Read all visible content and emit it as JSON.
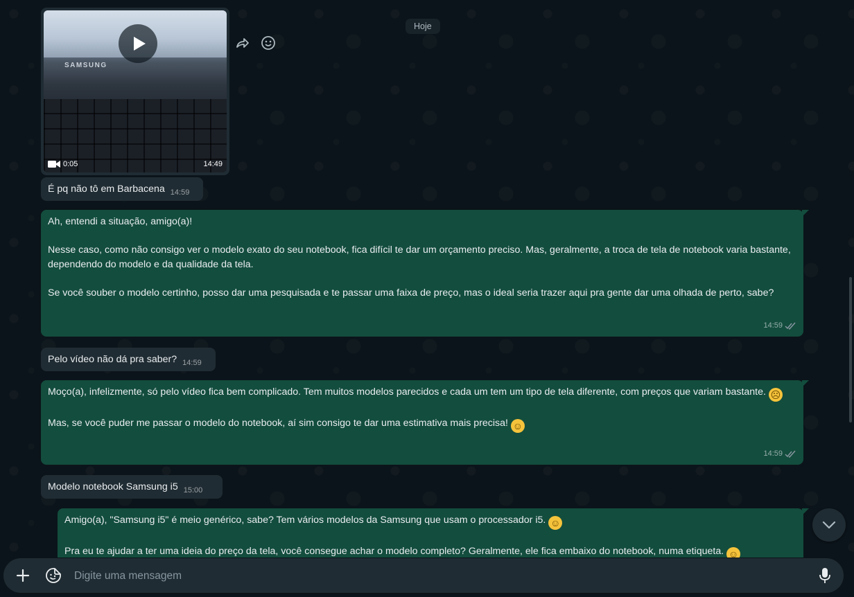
{
  "date_chip": "Hoje",
  "video_message": {
    "duration": "0:05",
    "time": "14:49",
    "thumb_brand": "SAMSUNG"
  },
  "messages": [
    {
      "direction": "incoming",
      "text": "É pq não tô em Barbacena",
      "time": "14:59"
    },
    {
      "direction": "outgoing",
      "text": "Ah, entendi a situação, amigo(a)!\n\nNesse caso, como não consigo ver o modelo exato do seu notebook, fica difícil te dar um orçamento preciso. Mas, geralmente, a troca de tela de notebook varia bastante, dependendo do modelo e da qualidade da tela.\n\nSe você souber o modelo certinho, posso dar uma pesquisada e te passar uma faixa de preço, mas o ideal seria trazer aqui pra gente dar uma olhada de perto, sabe?",
      "time": "14:59"
    },
    {
      "direction": "incoming",
      "text": "Pelo vídeo não dá pra saber?",
      "time": "14:59"
    },
    {
      "direction": "outgoing",
      "text_a": "Moço(a), infelizmente, só pelo vídeo fica bem complicado. Tem muitos modelos parecidos e cada um tem um tipo de tela diferente, com preços que variam bastante. ",
      "text_b": "\n\nMas, se você puder me passar o modelo do notebook, aí sim consigo te dar uma estimativa mais precisa! ",
      "time": "14:59"
    },
    {
      "direction": "incoming",
      "text": "Modelo notebook Samsung i5",
      "time": "15:00"
    },
    {
      "direction": "outgoing",
      "text_a": "Amigo(a), \"Samsung i5\" é meio genérico, sabe? Tem vários modelos da Samsung que usam o processador i5. ",
      "text_b": "\n\nPra eu te ajudar a ter uma ideia do preço da tela, você consegue achar o modelo completo? Geralmente, ele fica embaixo do notebook, numa etiqueta. "
    }
  ],
  "composer": {
    "placeholder": "Digite uma mensagem"
  },
  "icons": {
    "forward": "forward-icon",
    "reaction": "emoji-icon",
    "play": "play-icon",
    "video": "video-camera-icon",
    "read": "double-check-icon",
    "scroll": "chevron-down-icon",
    "attach": "plus-icon",
    "sticker": "sticker-icon",
    "mic": "microphone-icon"
  },
  "colors": {
    "background": "#0b141a",
    "incoming": "#202c33",
    "outgoing": "#134d3d",
    "read_ticks": "#8696a0"
  }
}
